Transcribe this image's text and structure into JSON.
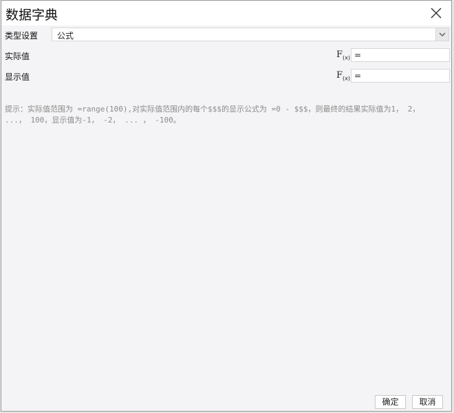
{
  "dialog": {
    "title": "数据字典",
    "close_icon": "close-icon"
  },
  "type_setting": {
    "label": "类型设置",
    "selected_value": "公式",
    "arrow_icon": "chevron-down-icon"
  },
  "actual_value": {
    "label": "实际值",
    "fx_icon": "formula-icon",
    "value": "="
  },
  "display_value": {
    "label": "显示值",
    "fx_icon": "formula-icon",
    "value": "="
  },
  "hint": {
    "text": "提示：实际值范围为 =range(100),对实际值范围内的每个$$$的显示公式为 =0 - $$$，则最终的结果实际值为1， 2， ...， 100，显示值为-1， -2， ... ， -100。"
  },
  "buttons": {
    "ok": "确定",
    "cancel": "取消"
  }
}
